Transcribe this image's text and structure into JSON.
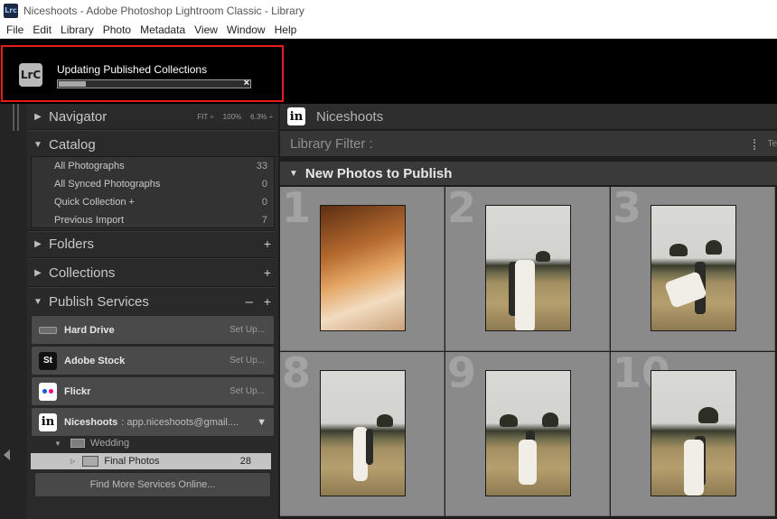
{
  "window": {
    "app_icon": "Lrc",
    "title": "Niceshoots - Adobe Photoshop Lightroom Classic - Library"
  },
  "menu": [
    "File",
    "Edit",
    "Library",
    "Photo",
    "Metadata",
    "View",
    "Window",
    "Help"
  ],
  "progress": {
    "logo": "LrC",
    "title": "Updating Published Collections",
    "fraction": 0.14,
    "cancel_glyph": "×"
  },
  "left_panel": {
    "navigator": {
      "label": "Navigator",
      "zoom_options": [
        "FIT ÷",
        "100%",
        "6.3% ÷"
      ]
    },
    "catalog": {
      "label": "Catalog",
      "items": [
        {
          "label": "All Photographs",
          "count": "33"
        },
        {
          "label": "All Synced Photographs",
          "count": "0"
        },
        {
          "label": "Quick Collection  +",
          "count": "0"
        },
        {
          "label": "Previous Import",
          "count": "7"
        }
      ]
    },
    "folders": {
      "label": "Folders"
    },
    "collections": {
      "label": "Collections"
    },
    "publish_services": {
      "label": "Publish Services",
      "services": [
        {
          "name": "Hard Drive",
          "action": "Set Up..."
        },
        {
          "name": "Adobe Stock",
          "action": "Set Up..."
        },
        {
          "name": "Flickr",
          "action": "Set Up..."
        }
      ],
      "niceshoots": {
        "icon_letter": "in",
        "name": "Niceshoots",
        "account": ":  app.niceshoots@gmail....",
        "collection_set": "Wedding",
        "collection": {
          "name": "Final Photos",
          "count": "28"
        }
      },
      "find_more": "Find More Services Online..."
    }
  },
  "main": {
    "logo_letter": "in",
    "title": "Niceshoots",
    "filter_label": "Library Filter :",
    "filter_right": "Te",
    "collection_title": "New Photos to Publish",
    "cells": [
      {
        "num": "1"
      },
      {
        "num": "2"
      },
      {
        "num": "3"
      },
      {
        "num": "8"
      },
      {
        "num": "9"
      },
      {
        "num": "10"
      }
    ]
  },
  "colors": {
    "highlight": "#e81a1a",
    "grid_cell": "#8a8a8a",
    "panel_bg": "#2a2a2a"
  },
  "icons": [
    "lrc-logo-icon",
    "triangle-right-icon",
    "triangle-down-icon",
    "plus-icon",
    "minus-icon",
    "hard-drive-icon",
    "adobe-stock-icon",
    "flickr-icon",
    "niceshoots-icon",
    "folder-icon",
    "collection-stack-icon",
    "close-icon",
    "chevron-down-icon"
  ]
}
